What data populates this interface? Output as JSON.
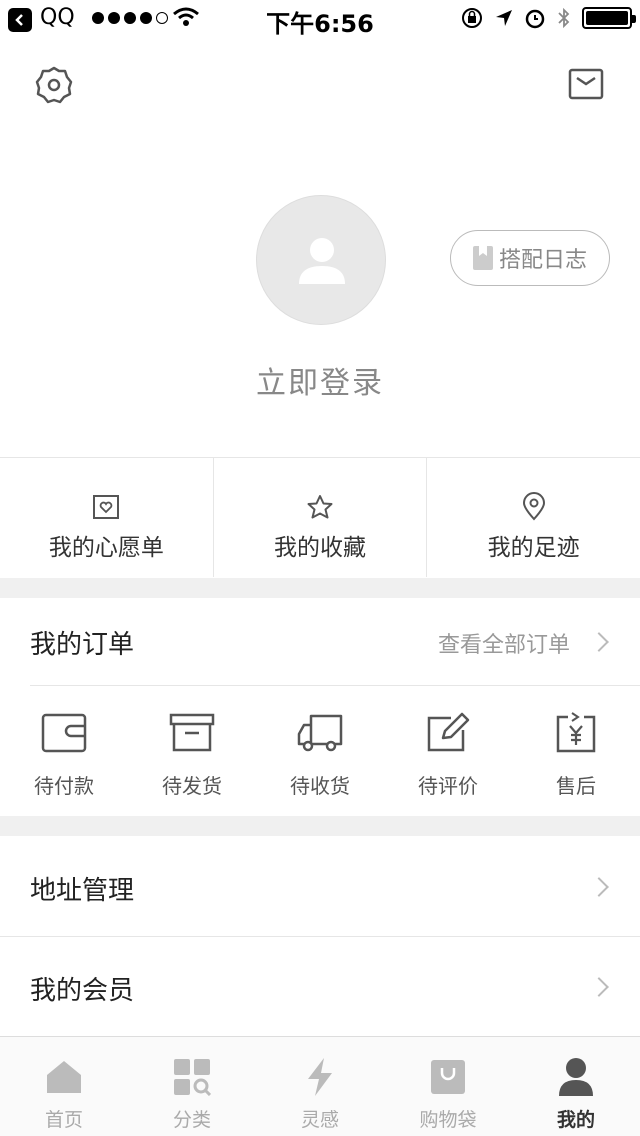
{
  "status_bar": {
    "app": "QQ",
    "time": "下午6:56"
  },
  "profile": {
    "login_label": "立即登录",
    "diary_label": "搭配日志"
  },
  "quick_links": [
    {
      "label": "我的心愿单",
      "icon": "wishlist-icon"
    },
    {
      "label": "我的收藏",
      "icon": "star-icon"
    },
    {
      "label": "我的足迹",
      "icon": "location-pin-icon"
    }
  ],
  "orders": {
    "title": "我的订单",
    "view_all": "查看全部订单",
    "items": [
      {
        "label": "待付款",
        "icon": "wallet-icon"
      },
      {
        "label": "待发货",
        "icon": "box-icon"
      },
      {
        "label": "待收货",
        "icon": "truck-icon"
      },
      {
        "label": "待评价",
        "icon": "edit-icon"
      },
      {
        "label": "售后",
        "icon": "refund-icon"
      }
    ]
  },
  "menu": {
    "address": "地址管理",
    "membership": "我的会员"
  },
  "tabs": [
    {
      "label": "首页",
      "icon": "home-icon"
    },
    {
      "label": "分类",
      "icon": "category-icon"
    },
    {
      "label": "灵感",
      "icon": "lightning-icon"
    },
    {
      "label": "购物袋",
      "icon": "shopping-bag-icon"
    },
    {
      "label": "我的",
      "icon": "user-icon",
      "active": true
    }
  ],
  "colors": {
    "icon_gray": "#555555",
    "inactive_tab": "#bbbbbb",
    "band": "#f0f0f0"
  }
}
